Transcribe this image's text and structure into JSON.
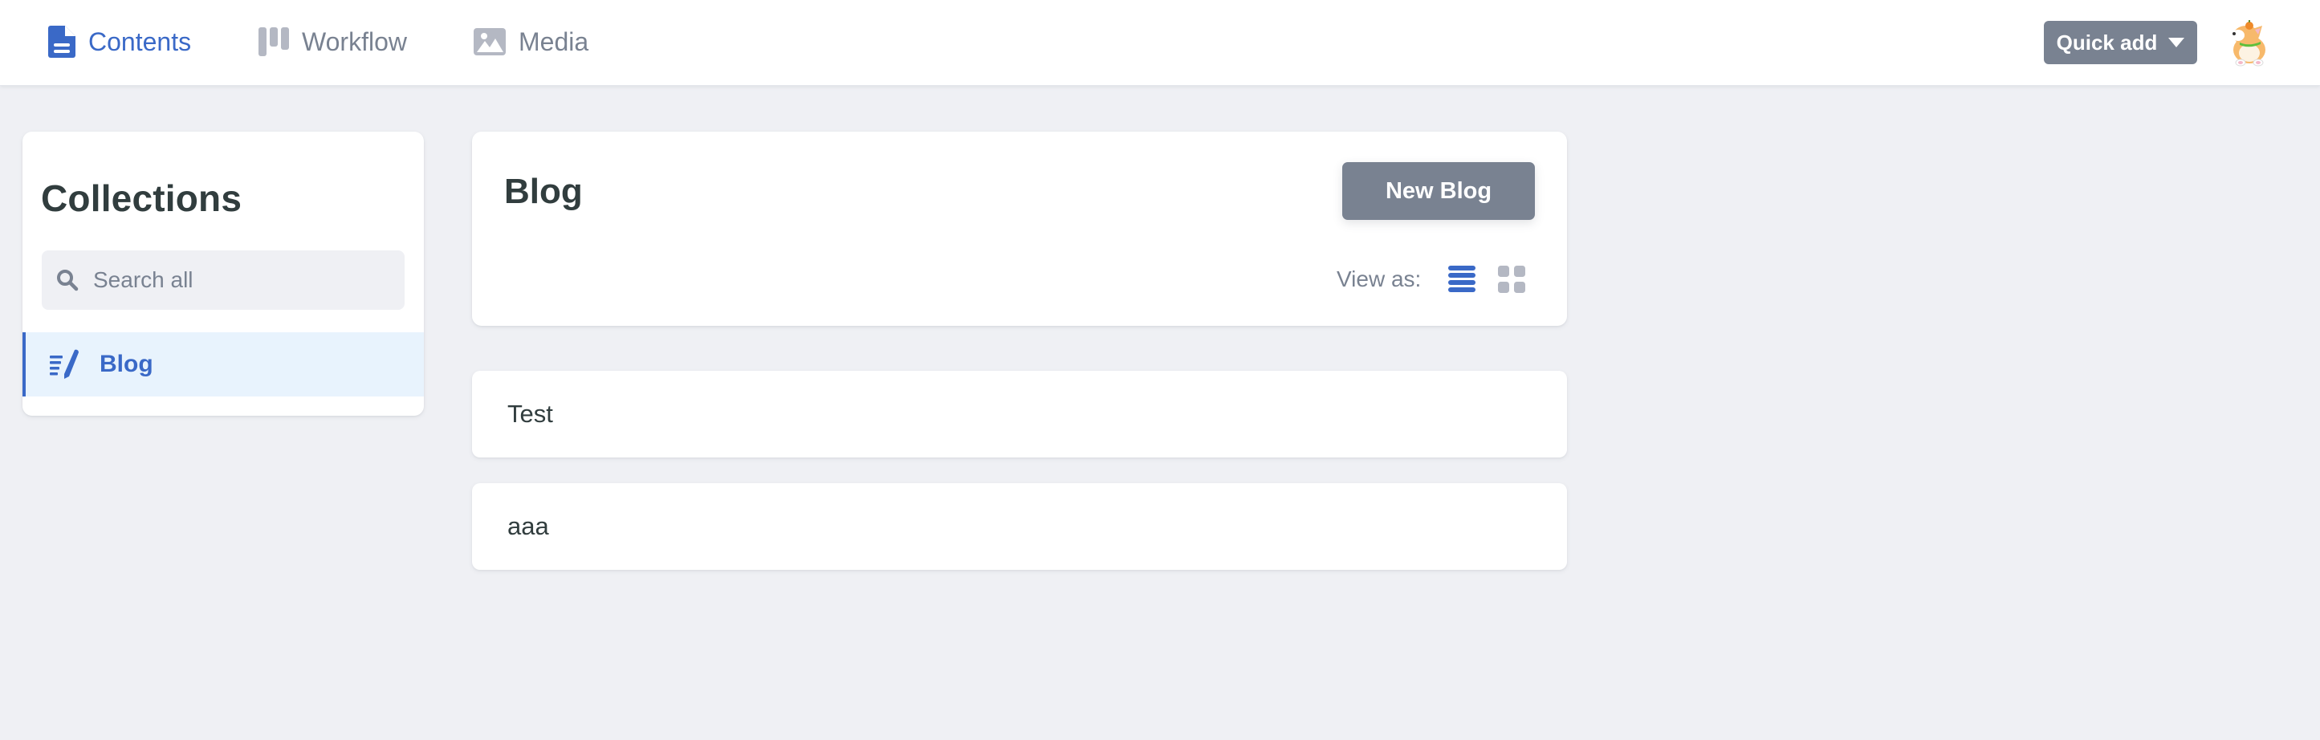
{
  "topbar": {
    "nav": [
      {
        "label": "Contents",
        "icon": "document-icon",
        "active": true
      },
      {
        "label": "Workflow",
        "icon": "kanban-icon",
        "active": false
      },
      {
        "label": "Media",
        "icon": "image-icon",
        "active": false
      }
    ],
    "quick_add_label": "Quick add",
    "avatar": "corgi-avatar"
  },
  "sidebar": {
    "title": "Collections",
    "search_placeholder": "Search all",
    "search_value": "",
    "items": [
      {
        "label": "Blog",
        "icon": "write-icon",
        "active": true
      }
    ]
  },
  "main": {
    "collection_title": "Blog",
    "new_button_label": "New Blog",
    "view_as_label": "View as:",
    "view_modes": [
      {
        "name": "list",
        "icon": "list-view-icon",
        "active": true
      },
      {
        "name": "grid",
        "icon": "grid-view-icon",
        "active": false
      }
    ],
    "entries": [
      {
        "title": "Test"
      },
      {
        "title": "aaa"
      }
    ]
  },
  "colors": {
    "accent": "#3a69c7",
    "muted": "#798291",
    "background": "#eff0f4",
    "text": "#313d3e",
    "active_item_bg": "#e8f3fd",
    "inactive_icon": "#b4b8c3"
  }
}
